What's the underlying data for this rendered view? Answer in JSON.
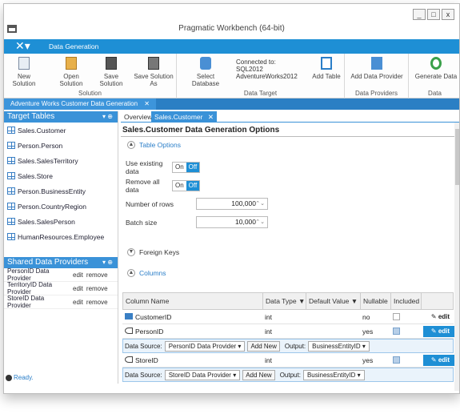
{
  "window": {
    "title": "Pragmatic Workbench (64-bit)",
    "buttons": [
      "_",
      "□",
      "x"
    ]
  },
  "ribbon": {
    "tab": "Data Generation",
    "solution": {
      "new": "New Solution",
      "open": "Open Solution",
      "save": "Save Solution",
      "save_as": "Save Solution As",
      "group": "Solution"
    },
    "target": {
      "select": "Select Database",
      "connected_label": "Connected to:",
      "server": "SQL2012",
      "database": "AdventureWorks2012",
      "add_table": "Add Table",
      "group": "Data Target"
    },
    "providers": {
      "add": "Add Data Provider",
      "group": "Data Providers"
    },
    "generate": {
      "label": "Generate Data",
      "group": "Data"
    }
  },
  "doc_tab": "Adventure Works Customer Data Generation",
  "left": {
    "target_header": "Target Tables",
    "tables": [
      "Sales.Customer",
      "Person.Person",
      "Sales.SalesTerritory",
      "Sales.Store",
      "Person.BusinessEntity",
      "Person.CountryRegion",
      "Sales.SalesPerson",
      "HumanResources.Employee"
    ],
    "providers_header": "Shared Data Providers",
    "providers": [
      {
        "name": "PersonID Data Provider",
        "edit": "edit",
        "remove": "remove"
      },
      {
        "name": "TerritoryID Data Provider",
        "edit": "edit",
        "remove": "remove"
      },
      {
        "name": "StoreID Data Provider",
        "edit": "edit",
        "remove": "remove"
      }
    ],
    "status": "Ready."
  },
  "main": {
    "tabs": [
      "Overview",
      "Sales.Customer"
    ],
    "section_title": "Sales.Customer Data Generation Options",
    "table_options": "Table Options",
    "use_existing": "Use existing data",
    "remove_all": "Remove all data",
    "on": "On",
    "off": "Off",
    "num_rows_label": "Number of rows",
    "num_rows": "100,000",
    "batch_label": "Batch size",
    "batch": "10,000",
    "foreign_keys": "Foreign Keys",
    "columns": "Columns",
    "col_headers": [
      "Column Name",
      "Data Type",
      "Default Value",
      "Nullable",
      "Included"
    ],
    "rows": [
      {
        "name": "CustomerID",
        "type": "int",
        "nullable": "no",
        "edit": "edit"
      },
      {
        "name": "PersonID",
        "type": "int",
        "nullable": "yes",
        "edit": "edit"
      },
      {
        "name": "StoreID",
        "type": "int",
        "nullable": "yes",
        "edit": "edit"
      }
    ],
    "ds1": {
      "label": "Data Source:",
      "source": "PersonID Data Provider",
      "add_new": "Add New",
      "output_label": "Output:",
      "output": "BusinessEntityID"
    },
    "ds2": {
      "label": "Data Source:",
      "source": "StoreID Data Provider",
      "add_new": "Add New",
      "output_label": "Output:",
      "output": "BusinessEntityID"
    }
  }
}
